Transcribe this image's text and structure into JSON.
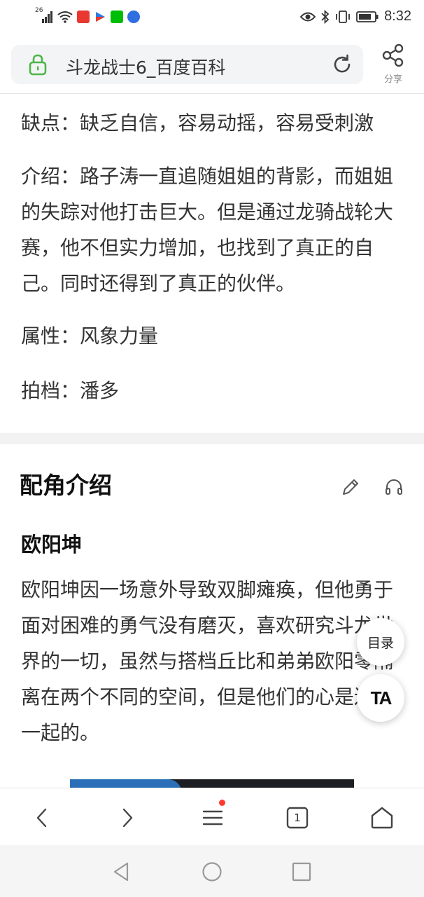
{
  "status_bar": {
    "signal_type": "26",
    "time": "8:32",
    "icons": [
      "signal-icon",
      "wifi-icon",
      "toutiao-app-icon",
      "video-app-icon",
      "iqiyi-app-icon",
      "baidu-app-icon",
      "eye-icon",
      "bluetooth-icon",
      "vibrate-icon",
      "battery-icon"
    ]
  },
  "address_bar": {
    "title": "斗龙战士6_百度百科",
    "share_label": "分享"
  },
  "content": {
    "paragraphs": [
      "缺点：缺乏自信，容易动摇，容易受刺激",
      "介绍：路子涛一直追随姐姐的背影，而姐姐的失踪对他打击巨大。但是通过龙骑战轮大赛，他不但实力增加，也找到了真正的自己。同时还得到了真正的伙伴。",
      "属性：风象力量",
      "拍档：潘多"
    ],
    "section_title": "配角介绍",
    "subsection_title": "欧阳坤",
    "subsection_text": "欧阳坤因一场意外导致双脚瘫痪，但他勇于面对困难的勇气没有磨灭，喜欢研究斗龙世界的一切，虽然与搭档丘比和弟弟欧阳零隔离在两个不同的空间，但是他们的心是连在一起的。"
  },
  "floating": {
    "toc_label": "目录",
    "ta_label": "TA"
  },
  "toolbar": {
    "tab_count": "1"
  },
  "colors": {
    "accent_green": "#4cb648",
    "notification_red": "#ff3b30"
  }
}
